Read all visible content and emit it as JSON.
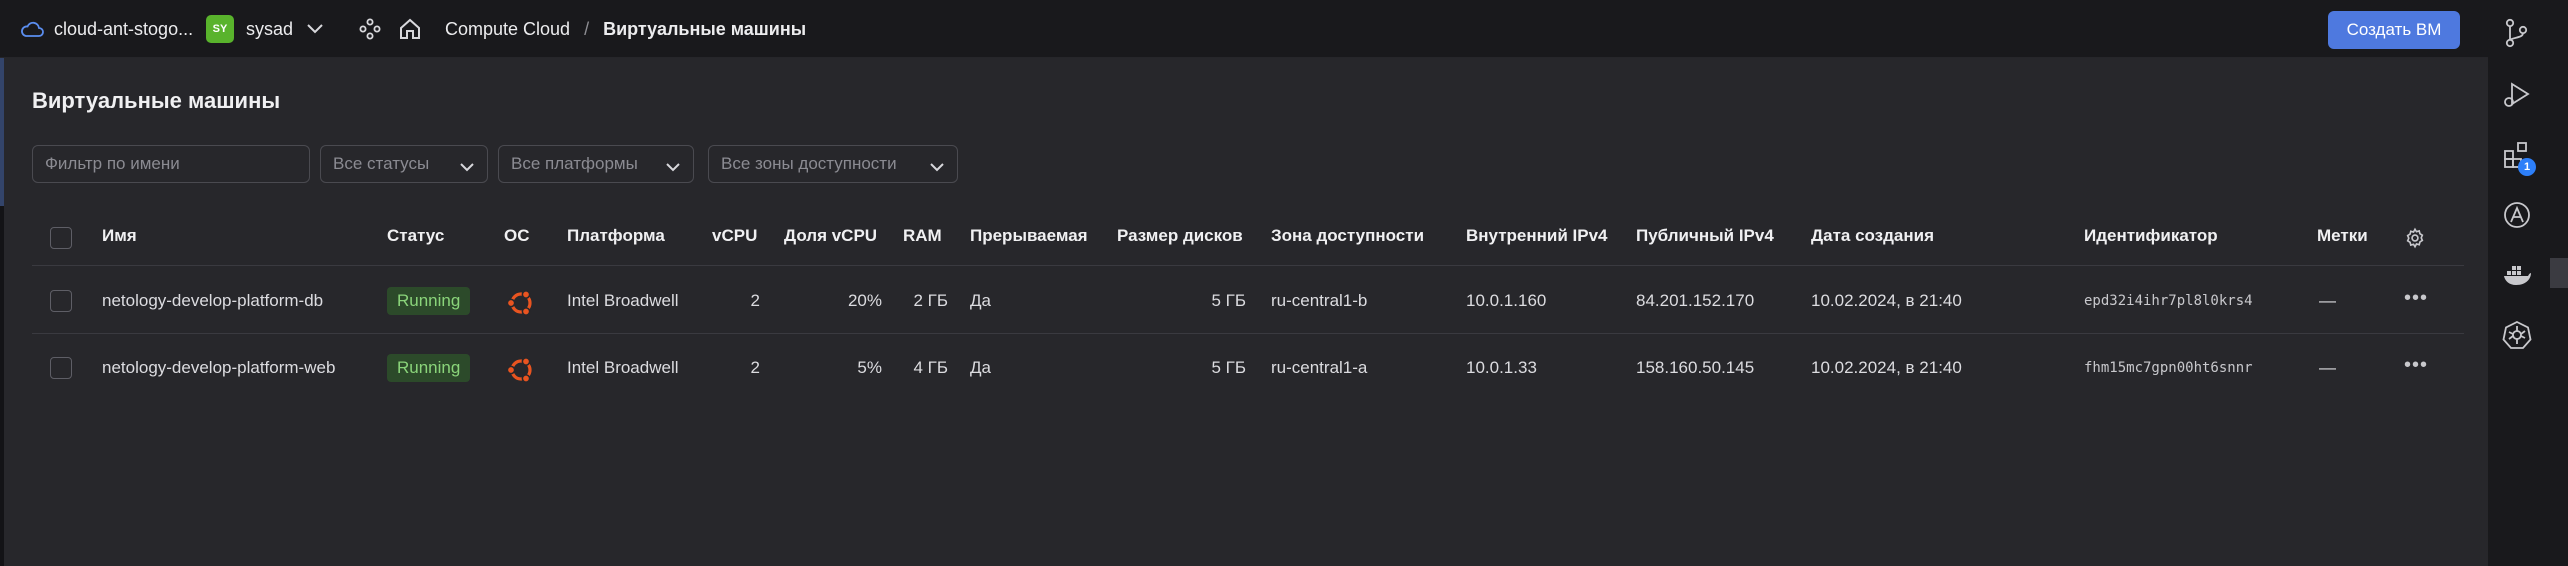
{
  "header": {
    "cloud_name": "cloud-ant-stogo...",
    "folder_badge": "SY",
    "folder_name": "sysad",
    "breadcrumb_service": "Compute Cloud",
    "breadcrumb_sep": "/",
    "breadcrumb_current": "Виртуальные машины",
    "create_button": "Создать ВМ"
  },
  "page": {
    "title": "Виртуальные машины"
  },
  "filters": {
    "name_placeholder": "Фильтр по имени",
    "status": "Все статусы",
    "platform": "Все платформы",
    "zone": "Все зоны доступности"
  },
  "table": {
    "columns": {
      "name": "Имя",
      "status": "Статус",
      "os": "ОС",
      "platform": "Платформа",
      "vcpu": "vCPU",
      "vcpu_share": "Доля vCPU",
      "ram": "RAM",
      "preemptible": "Прерываемая",
      "disk_size": "Размер дисков",
      "zone": "Зона доступности",
      "internal_ip": "Внутренний IPv4",
      "public_ip": "Публичный IPv4",
      "created": "Дата создания",
      "id": "Идентификатор",
      "labels": "Метки"
    },
    "rows": [
      {
        "name": "netology-develop-platform-db",
        "status": "Running",
        "platform": "Intel Broadwell",
        "vcpu": "2",
        "vcpu_share": "20%",
        "ram": "2 ГБ",
        "preemptible": "Да",
        "disk_size": "5 ГБ",
        "zone": "ru-central1-b",
        "internal_ip": "10.0.1.160",
        "public_ip": "84.201.152.170",
        "created": "10.02.2024, в 21:40",
        "id": "epd32i4ihr7pl8l0krs4",
        "labels": "—",
        "more": "•••"
      },
      {
        "name": "netology-develop-platform-web",
        "status": "Running",
        "platform": "Intel Broadwell",
        "vcpu": "2",
        "vcpu_share": "5%",
        "ram": "4 ГБ",
        "preemptible": "Да",
        "disk_size": "5 ГБ",
        "zone": "ru-central1-a",
        "internal_ip": "10.0.1.33",
        "public_ip": "158.160.50.145",
        "created": "10.02.2024, в 21:40",
        "id": "fhm15mc7gpn00ht6snnr",
        "labels": "—",
        "more": "•••"
      }
    ]
  },
  "rail": {
    "extensions_badge": "1"
  },
  "colors": {
    "accent": "#4e79df",
    "running_bg": "#2c4a2a",
    "running_text": "#8ad47a",
    "ubuntu": "#e95420",
    "folder_badge": "#59b32c"
  }
}
